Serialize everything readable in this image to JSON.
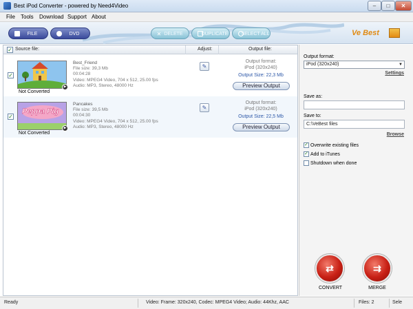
{
  "window": {
    "title": "Best iPod Converter - powered by Need4Video",
    "minimize": "–",
    "maximize": "□",
    "close": "✕"
  },
  "menu": [
    "File",
    "Tools",
    "Download",
    "Support",
    "About"
  ],
  "toolbar": {
    "file_label": "FILE",
    "dvd_label": "DVD",
    "delete_label": "DELETE",
    "duplicate_label": "DUPLICATE",
    "select_all_label": "SELECT ALL",
    "brand": "Ve Best"
  },
  "list": {
    "headers": {
      "source": "Source file:",
      "adjust": "Adjust:",
      "output": "Output file:"
    },
    "files": [
      {
        "checked": true,
        "name": "Best_Friend",
        "size": "File size: 39,3 Mb",
        "duration": "00:04:28",
        "video": "Video: MPEG4 Video, 704 x 512, 25.00 fps",
        "audio": "Audio: MP3, Stereo, 48000 Hz",
        "status": "Not Converted",
        "output_format_label": "Output format:",
        "output_format": "iPod (320x240)",
        "output_size": "Output Size: 22,3 Mb",
        "preview_label": "Preview Output"
      },
      {
        "checked": true,
        "name": "Pancakes",
        "size": "File size: 39,5 Mb",
        "duration": "00:04:30",
        "video": "Video: MPEG4 Video, 704 x 512, 25.00 fps",
        "audio": "Audio: MP3, Stereo, 48000 Hz",
        "status": "Not Converted",
        "thumb_text": "Peppa Pig",
        "output_format_label": "Output format:",
        "output_format": "iPod (320x240)",
        "output_size": "Output Size: 22,5 Mb",
        "preview_label": "Preview Output"
      }
    ]
  },
  "settings": {
    "output_format_label": "Output format:",
    "output_format_value": "iPod (320x240)",
    "settings_link": "Settings",
    "save_as_label": "Save as:",
    "save_as_value": "",
    "save_to_label": "Save to:",
    "save_to_value": "C:\\VeBest files",
    "browse_link": "Browse",
    "options": [
      {
        "label": "Overwrite existing files",
        "checked": true
      },
      {
        "label": "Add to iTunes",
        "checked": true
      },
      {
        "label": "Shutdown when done",
        "checked": false
      }
    ],
    "convert_label": "CONVERT",
    "merge_label": "MERGE"
  },
  "status_bar": {
    "state": "Ready",
    "video_info": "Video: Frame: 320x240, Codec: MPEG4 Video; Audio: 44Khz, AAC",
    "files": "Files: 2",
    "selected": "Sele"
  },
  "colors": {
    "accent_red": "#c82015",
    "toolbar_dark": "#3a4a9c",
    "toolbar_light": "#88c2d6",
    "brand_orange": "#e08a12"
  }
}
